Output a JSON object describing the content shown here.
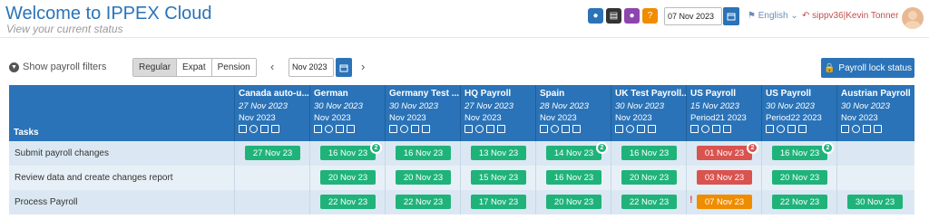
{
  "header": {
    "title": "Welcome to IPPEX Cloud",
    "subtitle": "View your current status",
    "date_value": "07 Nov 2023",
    "language": "English",
    "user": "sippv36|Kevin Tonner",
    "toolbar_icons": [
      {
        "name": "user-icon",
        "color": "#2a73b8"
      },
      {
        "name": "id-card-icon",
        "color": "#333333"
      },
      {
        "name": "users-icon",
        "color": "#8e44ad"
      },
      {
        "name": "help-icon",
        "color": "#f08c00"
      }
    ]
  },
  "filters": {
    "show_label": "Show payroll filters",
    "segments": [
      "Regular",
      "Expat",
      "Pension"
    ],
    "active_segment": "Regular",
    "period": "Nov 2023",
    "lock_button": "Payroll lock status"
  },
  "grid": {
    "tasks_header": "Tasks",
    "columns": [
      {
        "name": "Canada auto-u...",
        "date": "27 Nov 2023",
        "period": "Nov 2023"
      },
      {
        "name": "German",
        "date": "30 Nov 2023",
        "period": "Nov 2023"
      },
      {
        "name": "Germany Test ...",
        "date": "30 Nov 2023",
        "period": "Nov 2023"
      },
      {
        "name": "HQ Payroll",
        "date": "27 Nov 2023",
        "period": "Nov 2023"
      },
      {
        "name": "Spain",
        "date": "28 Nov 2023",
        "period": "Nov 2023"
      },
      {
        "name": "UK Test Payroll...",
        "date": "30 Nov 2023",
        "period": "Nov 2023"
      },
      {
        "name": "US Payroll",
        "date": "15 Nov 2023",
        "period": "Period21 2023"
      },
      {
        "name": "US Payroll",
        "date": "30 Nov 2023",
        "period": "Period22 2023"
      },
      {
        "name": "Austrian Payroll",
        "date": "30 Nov 2023",
        "period": "Nov 2023"
      }
    ],
    "rows": [
      {
        "label": "Submit payroll changes",
        "cells": [
          {
            "text": "27 Nov 23",
            "status": "green"
          },
          {
            "text": "16 Nov 23",
            "status": "green",
            "badge": "2"
          },
          {
            "text": "16 Nov 23",
            "status": "green"
          },
          {
            "text": "13 Nov 23",
            "status": "green"
          },
          {
            "text": "14 Nov 23",
            "status": "green",
            "badge": "2"
          },
          {
            "text": "16 Nov 23",
            "status": "green"
          },
          {
            "text": "01 Nov 23",
            "status": "red",
            "badge": "2"
          },
          {
            "text": "16 Nov 23",
            "status": "green",
            "badge": "2"
          },
          null
        ]
      },
      {
        "label": "Review data and create changes report",
        "cells": [
          null,
          {
            "text": "20 Nov 23",
            "status": "green"
          },
          {
            "text": "20 Nov 23",
            "status": "green"
          },
          {
            "text": "15 Nov 23",
            "status": "green"
          },
          {
            "text": "16 Nov 23",
            "status": "green"
          },
          {
            "text": "20 Nov 23",
            "status": "green"
          },
          {
            "text": "03 Nov 23",
            "status": "red"
          },
          {
            "text": "20 Nov 23",
            "status": "green"
          },
          null
        ]
      },
      {
        "label": "Process Payroll",
        "cells": [
          null,
          {
            "text": "22 Nov 23",
            "status": "green"
          },
          {
            "text": "22 Nov 23",
            "status": "green"
          },
          {
            "text": "17 Nov 23",
            "status": "green"
          },
          {
            "text": "20 Nov 23",
            "status": "green"
          },
          {
            "text": "22 Nov 23",
            "status": "green"
          },
          {
            "text": "07 Nov 23",
            "status": "orange",
            "warning": "!"
          },
          {
            "text": "22 Nov 23",
            "status": "green"
          },
          {
            "text": "30 Nov 23",
            "status": "green"
          }
        ]
      }
    ],
    "colors": {
      "green": "#1fb37a",
      "red": "#d9534f",
      "orange": "#f08c00"
    }
  }
}
